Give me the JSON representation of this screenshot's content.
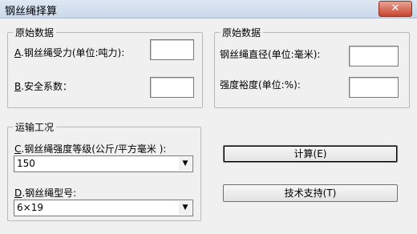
{
  "window": {
    "title": "钢丝绳择算",
    "close_label": "✕"
  },
  "left_group": {
    "legend": "原始数据",
    "force_mnemonic": "A",
    "force_label": ".钢丝绳受力(单位:吨力):",
    "safety_mnemonic": "B",
    "safety_label": ".安全系数：",
    "force_value": "",
    "safety_value": ""
  },
  "right_group": {
    "legend": "原始数据",
    "diameter_label": "钢丝绳直径(单位:毫米):",
    "margin_label": "强度裕度(单位:%):",
    "diameter_value": "",
    "margin_value": ""
  },
  "transport_group": {
    "legend": "运输工况",
    "grade_mnemonic": "C",
    "grade_label": ".钢丝绳强度等级(公斤/平方毫米 ):",
    "grade_value": "150",
    "type_mnemonic": "D",
    "type_label": ".钢丝绳型号:",
    "type_value": "6×19"
  },
  "buttons": {
    "calc_label": "计算(E)",
    "support_label": "技术支持(T)"
  },
  "icons": {
    "dropdown": "chevron-down-icon",
    "close": "close-icon"
  }
}
